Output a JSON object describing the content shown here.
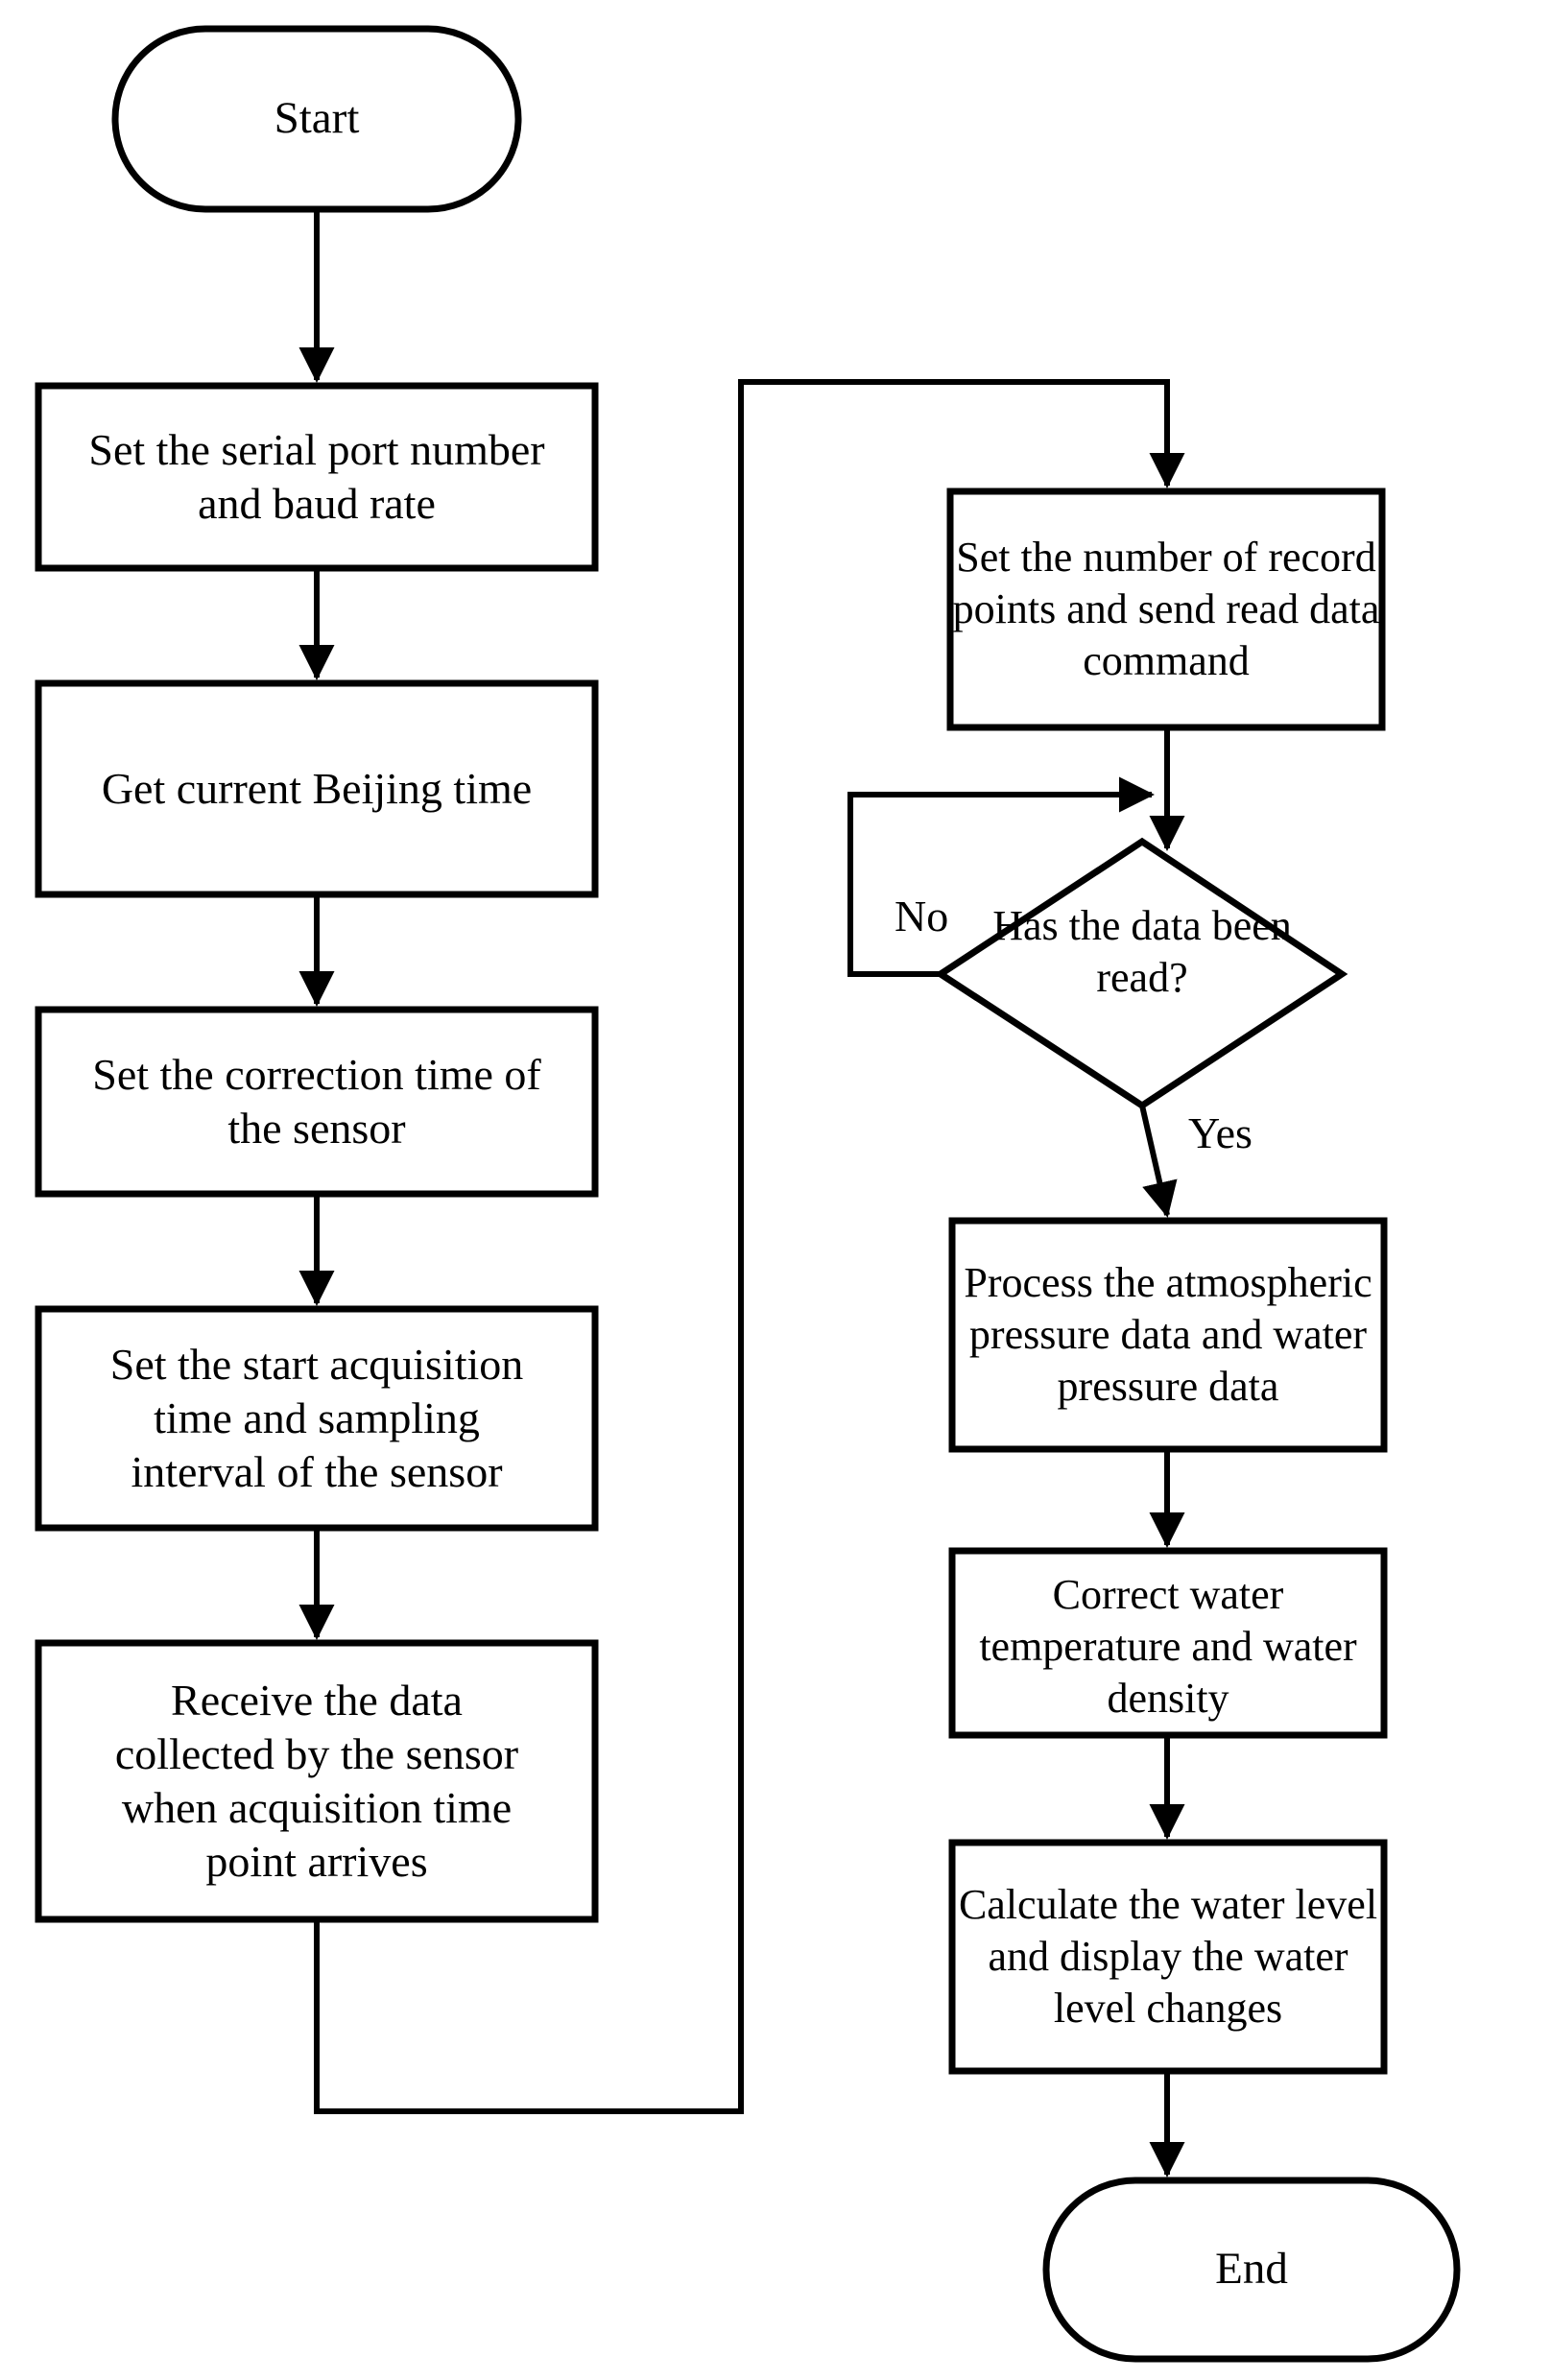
{
  "diagram": {
    "title": "Water level measurement program flowchart",
    "stroke_color": "#000000",
    "fill_color": "#ffffff",
    "background": "#ffffff"
  },
  "nodes": {
    "start": {
      "label": "Start",
      "shape": "terminator"
    },
    "set_serial": {
      "label": "Set the serial port number\nand baud rate",
      "shape": "process"
    },
    "get_time": {
      "label": "Get current Beijing time",
      "shape": "process"
    },
    "set_correction": {
      "label": "Set the correction time of\nthe sensor",
      "shape": "process"
    },
    "set_acquisition": {
      "label": "Set the start acquisition\ntime and sampling\ninterval of the sensor",
      "shape": "process"
    },
    "receive_data": {
      "label": "Receive the data\ncollected by the sensor\nwhen acquisition time\npoint arrives",
      "shape": "process"
    },
    "set_record_points": {
      "label": "Set the number of record\npoints and send read data\ncommand",
      "shape": "process"
    },
    "has_data_been_read": {
      "label": "Has the data been\nread?",
      "shape": "decision"
    },
    "process_pressure": {
      "label": "Process the atmospheric\npressure data and water\npressure data",
      "shape": "process"
    },
    "correct_water": {
      "label": "Correct water\ntemperature and water\ndensity",
      "shape": "process"
    },
    "calculate_level": {
      "label": "Calculate the water level\nand display the water\nlevel changes",
      "shape": "process"
    },
    "end": {
      "label": "End",
      "shape": "terminator"
    }
  },
  "edge_labels": {
    "no": "No",
    "yes": "Yes"
  }
}
